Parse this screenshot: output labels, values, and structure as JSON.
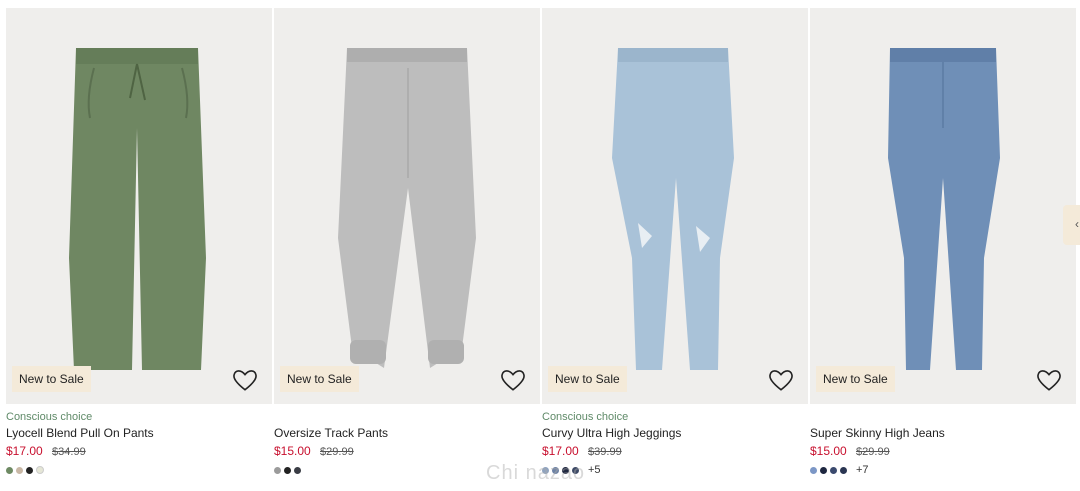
{
  "products": [
    {
      "name": "Lyocell Blend Pull On Pants",
      "conscious": "Conscious choice",
      "badge": "New to Sale",
      "price_sale": "$17.00",
      "price_old": "$34.99",
      "swatch_colors": [
        "#6e8a63",
        "#c9b8a6",
        "#222222",
        "#e5e6d6"
      ],
      "more": "",
      "product_color": "#6f8762"
    },
    {
      "name": "Oversize Track Pants",
      "conscious": "",
      "badge": "New to Sale",
      "price_sale": "$15.00",
      "price_old": "$29.99",
      "swatch_colors": [
        "#9b9b9b",
        "#222222",
        "#3a3d45"
      ],
      "more": "",
      "product_color": "#b9b9b9"
    },
    {
      "name": "Curvy Ultra High Jeggings",
      "conscious": "Conscious choice",
      "badge": "New to Sale",
      "price_sale": "$17.00",
      "price_old": "$39.99",
      "swatch_colors": [
        "#8fa3bf",
        "#6d82a5",
        "#1f2740",
        "#3d4a66"
      ],
      "more": "+5",
      "product_color": "#a9c2d8"
    },
    {
      "name": "Super Skinny High Jeans",
      "conscious": "",
      "badge": "New to Sale",
      "price_sale": "$15.00",
      "price_old": "$29.99",
      "swatch_colors": [
        "#7c97c6",
        "#1e2740",
        "#3b4a6e",
        "#2a3552"
      ],
      "more": "+7",
      "product_color": "#6f8fb7"
    }
  ],
  "icons": {
    "heart": "heart-icon",
    "next": "chevron-right-icon"
  },
  "colors": {
    "sale_price": "#c8102e",
    "conscious": "#5f8a68",
    "badge_bg": "#f4ead9",
    "image_bg": "#efeeec"
  },
  "watermark": "Chi nazao"
}
